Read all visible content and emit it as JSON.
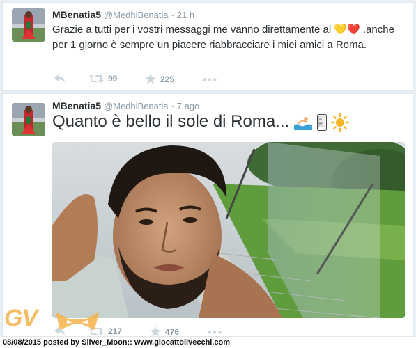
{
  "tweets": [
    {
      "display_name": "MBenatia5",
      "handle": "@MedhiBenatia",
      "separator": "·",
      "time": "21 h",
      "text": "Grazie a tutti per i vostri messaggi me vanno direttamente al 💛❤️ .anche per 1 giorno è sempre un piacere riabbracciare i miei amici a Roma.",
      "retweets": "99",
      "favorites": "225"
    },
    {
      "display_name": "MBenatia5",
      "handle": "@MedhiBenatia",
      "separator": "·",
      "time": "7 ago",
      "text": "Quanto è bello il sole di Roma...",
      "retweets": "217",
      "favorites": "476"
    }
  ],
  "icons": [
    "reply-icon",
    "retweet-icon",
    "favorite-star-icon",
    "more-icon",
    "swimmer-emoji",
    "phone-emoji",
    "sun-emoji"
  ],
  "colors": {
    "action_gray": "#8899a6",
    "name": "#292f33",
    "watermark": "#f5b24a"
  },
  "watermark": {
    "logo": "GV"
  },
  "footer": {
    "credit": "08/08/2015 posted by Silver_Moon:: www.giocattolivecchi.com"
  }
}
